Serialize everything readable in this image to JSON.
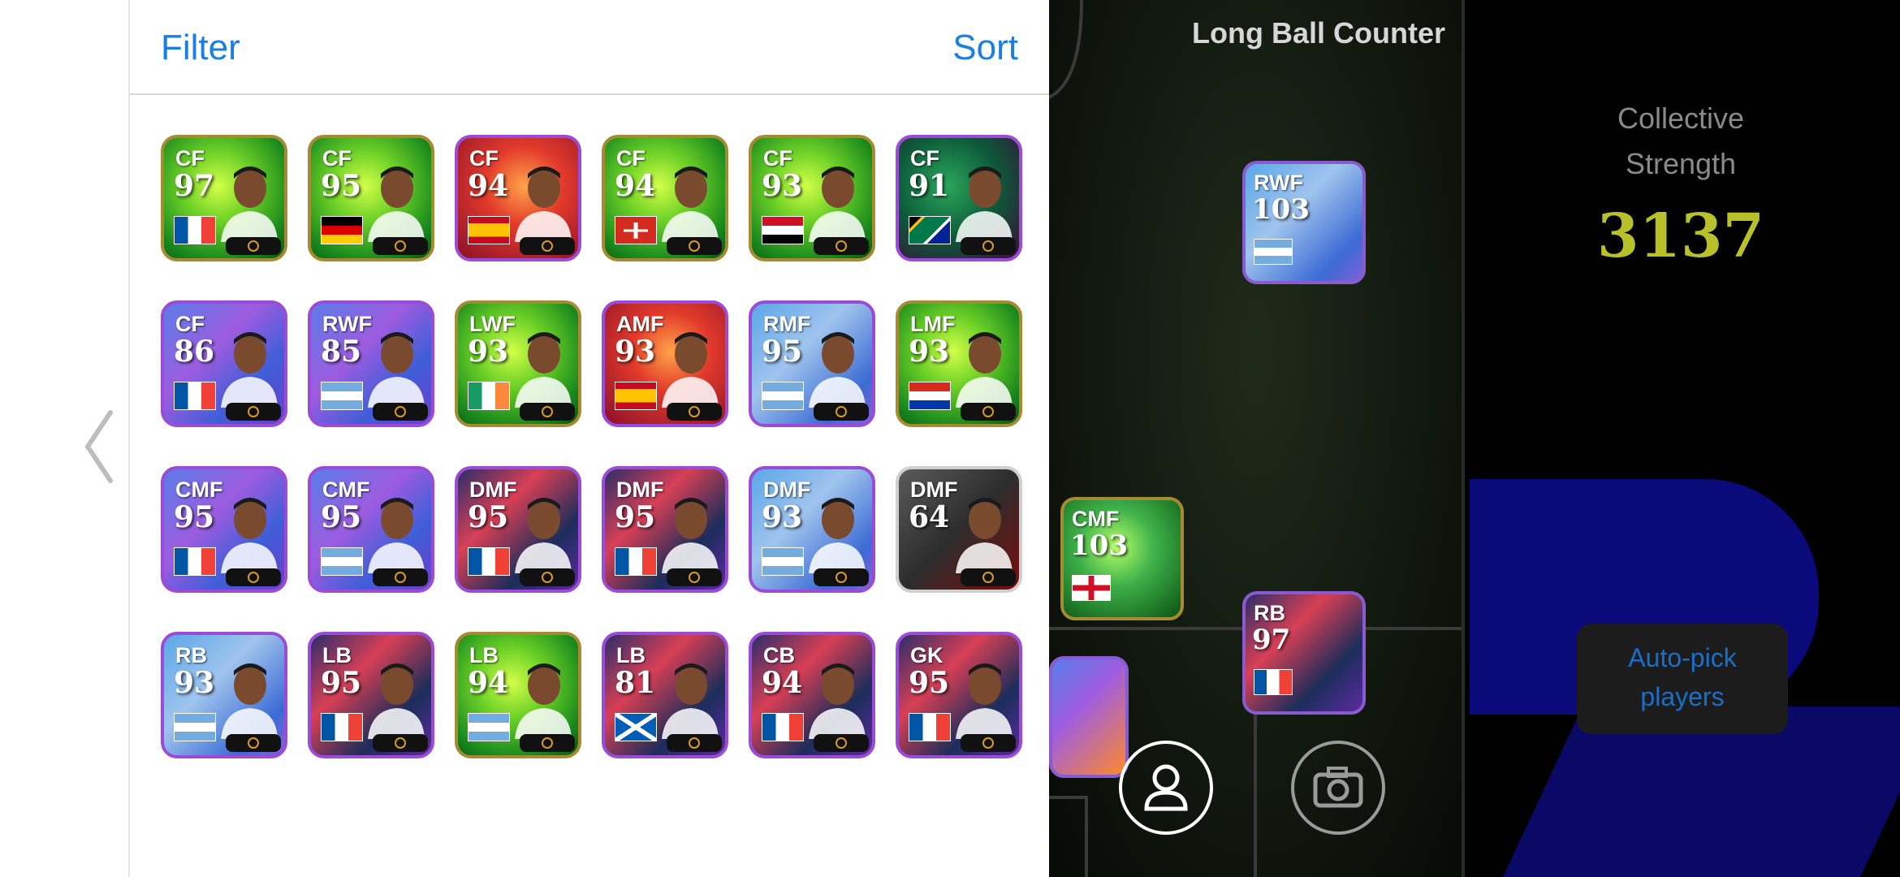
{
  "panel": {
    "filter_label": "Filter",
    "sort_label": "Sort"
  },
  "players": [
    {
      "pos": "CF",
      "ovr": "97",
      "flag": "france",
      "style": "green"
    },
    {
      "pos": "CF",
      "ovr": "95",
      "flag": "germany",
      "style": "green"
    },
    {
      "pos": "CF",
      "ovr": "94",
      "flag": "spain",
      "style": "red"
    },
    {
      "pos": "CF",
      "ovr": "94",
      "flag": "switzerland",
      "style": "green"
    },
    {
      "pos": "CF",
      "ovr": "93",
      "flag": "iraq",
      "style": "green"
    },
    {
      "pos": "CF",
      "ovr": "91",
      "flag": "south-africa",
      "style": "teal"
    },
    {
      "pos": "CF",
      "ovr": "86",
      "flag": "france",
      "style": "purple"
    },
    {
      "pos": "RWF",
      "ovr": "85",
      "flag": "argentina",
      "style": "purple"
    },
    {
      "pos": "LWF",
      "ovr": "93",
      "flag": "ireland",
      "style": "green"
    },
    {
      "pos": "AMF",
      "ovr": "93",
      "flag": "spain",
      "style": "red"
    },
    {
      "pos": "RMF",
      "ovr": "95",
      "flag": "argentina",
      "style": "steel"
    },
    {
      "pos": "LMF",
      "ovr": "93",
      "flag": "paraguay",
      "style": "green"
    },
    {
      "pos": "CMF",
      "ovr": "95",
      "flag": "france",
      "style": "purple"
    },
    {
      "pos": "CMF",
      "ovr": "95",
      "flag": "argentina",
      "style": "purple"
    },
    {
      "pos": "DMF",
      "ovr": "95",
      "flag": "france",
      "style": "navyr"
    },
    {
      "pos": "DMF",
      "ovr": "95",
      "flag": "france",
      "style": "navyr"
    },
    {
      "pos": "DMF",
      "ovr": "93",
      "flag": "argentina",
      "style": "steel"
    },
    {
      "pos": "DMF",
      "ovr": "64",
      "flag": "none",
      "style": "grey"
    },
    {
      "pos": "RB",
      "ovr": "93",
      "flag": "argentina",
      "style": "steel"
    },
    {
      "pos": "LB",
      "ovr": "95",
      "flag": "france",
      "style": "navyr"
    },
    {
      "pos": "LB",
      "ovr": "94",
      "flag": "argentina",
      "style": "green"
    },
    {
      "pos": "LB",
      "ovr": "81",
      "flag": "scotland",
      "style": "navyr"
    },
    {
      "pos": "CB",
      "ovr": "94",
      "flag": "france",
      "style": "navyr"
    },
    {
      "pos": "GK",
      "ovr": "95",
      "flag": "france",
      "style": "navyr"
    }
  ],
  "formation": {
    "title": "Long Ball Counter",
    "cards": [
      {
        "pos": "RWF",
        "ovr": "103",
        "flag": "argentina"
      },
      {
        "pos": "CMF",
        "ovr": "103",
        "flag": "england"
      },
      {
        "pos": "RB",
        "ovr": "97",
        "flag": "france"
      }
    ]
  },
  "collective": {
    "label_line1": "Collective",
    "label_line2": "Strength",
    "value": "3137"
  },
  "auto_pick": {
    "line1": "Auto-pick",
    "line2": "players"
  },
  "colors": {
    "accent": "#1a7fe0",
    "strength": "#b9c12a"
  }
}
